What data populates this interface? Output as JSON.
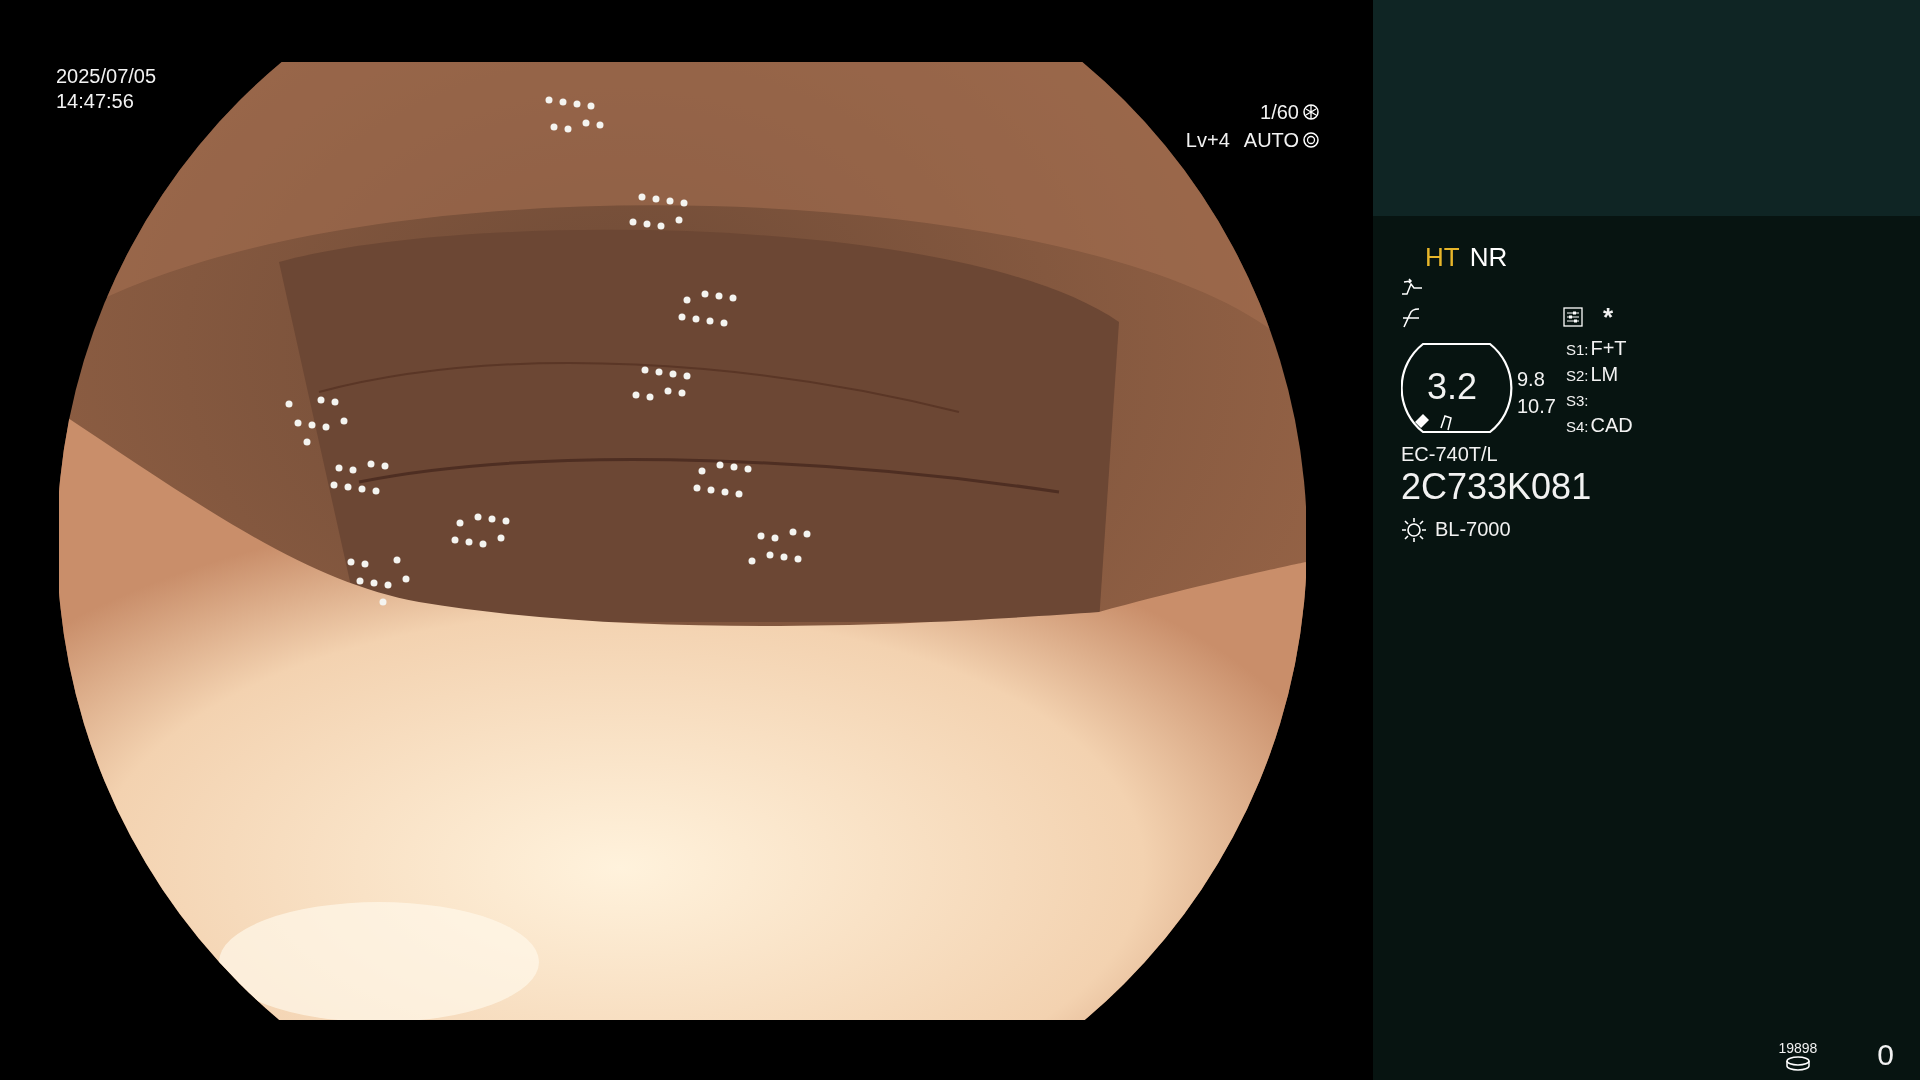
{
  "timestamp": {
    "date": "2025/07/05",
    "time": "14:47:56"
  },
  "exposure": {
    "shutter": "1/60",
    "level": "Lv+4",
    "mode": "AUTO"
  },
  "panel": {
    "modes": [
      {
        "label": "HT",
        "color": "#e8b62a"
      },
      {
        "label": "NR",
        "color": "#ffffff"
      }
    ],
    "zoom": {
      "value": "3.2",
      "readings": [
        "9.8",
        "10.7"
      ]
    },
    "settings_mark": "*",
    "switches": [
      {
        "label": "S1:",
        "value": "F+T"
      },
      {
        "label": "S2:",
        "value": "LM"
      },
      {
        "label": "S3:"
      },
      {
        "label": "S4:",
        "value": "CAD"
      }
    ],
    "scope_model": "EC-740T/L",
    "scope_serial": "2C733K081",
    "light_source": "BL-7000",
    "storage_count": "19898",
    "capture_count": "0"
  }
}
